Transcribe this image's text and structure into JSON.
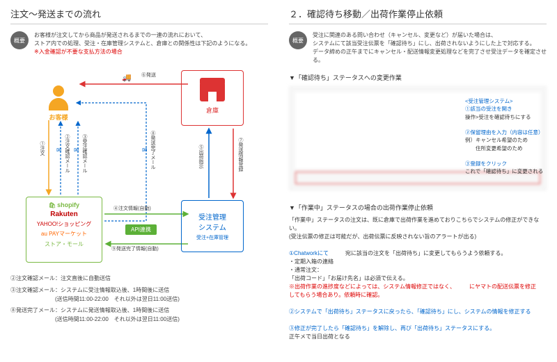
{
  "left": {
    "title": "注文～発送までの流れ",
    "badge": "概要",
    "summary_l1": "お客様が注文してから商品が発送されるまでの一連の流れにおいて、",
    "summary_l2": "ストア内での処理、受注・在庫管理システムと、倉庫との関係性は下記のようになる。",
    "summary_l3": "※入金確認が不要な支払方法の場合",
    "customer": "お客様",
    "warehouse": "倉庫",
    "oms_title": "受注管理\nシステム",
    "oms_sub": "受注+在庫管理",
    "shopify": "shopify",
    "rakuten": "Rakuten",
    "yahoo": "YAHOO!ショッピング",
    "aupay": "au PAYマーケット",
    "store": "ストア・モール",
    "api": "API連携",
    "arrows": {
      "order": "①注文",
      "confirm_mail": "②注文確認メール",
      "accept_mail": "③受注確認メール",
      "ship_done_mail": "⑧発送完了メール",
      "order_info": "④注文情報(自動)",
      "ship_done_info": "⑨発送完了情報(自動)",
      "ship_instr": "⑤出荷指示",
      "ship_report": "⑦発送情報登録",
      "shipping": "⑥発送"
    },
    "notes": {
      "n2": "②注文確認メール：注文直後に自動送信",
      "n3": "③注文確認メール：システムに受注情報取込後、1時間後に送信",
      "n3b": "(送信時間11:00-22:00　それ以外は翌日11:00送信)",
      "n8": "⑧発送完了メール：システムに発送情報取込後、1時間後に送信",
      "n8b": "(送信時間11:00-22:00　それ以外は翌日11:00送信)"
    }
  },
  "right": {
    "title": "２．確認待ち移動／出荷作業停止依頼",
    "badge": "概要",
    "summary_l1": "受注に関連のある問い合わせ（キャンセル、変更など）が届いた場合は、",
    "summary_l2": "システムにて該当受注伝票を「確認待ち」にし、出荷されないようにした上で対応する。",
    "summary_l3": "データ締めの正午までにキャンセル・配送情報変更処理などを完了させ受注データを確定させる。",
    "sec1": "▼「確認待ち」ステータスへの変更作業",
    "side_title": "<受注管理システム>",
    "s1": "①該当の受注を開き",
    "s1b": "操作>受注を確認待ちにする",
    "s2": "②保留理由を入力（内容は任意）",
    "s2a": "例）キャンセル希望のため",
    "s2b": "　　住所変更希望のため",
    "s3": "③登録をクリック",
    "s3b": "これで「確認待ち」に変更される",
    "sec2": "▼「作業中」ステータスの場合の出荷作業停止依頼",
    "w1": "「作業中」ステータスの注文は、既に倉庫で出荷作業を進めておりこちらでシステムの修正ができない。",
    "w1b": "(受注伝票の修正は可能だが、出荷伝票に反映されない旨のアラートが出る)",
    "w2a": "①Chatworkにて",
    "w2b": "宛に該当の注文を「出荷待ち」に変更してもらうよう依頼する。",
    "w3a": "・定期入箱の連絡",
    "w3b": "・通常注文：",
    "w3c": "「出荷コード」「お届け先名」は必須で伝える。",
    "w3d": "※出荷作業の進捗度などによっては、システム情報修正ではなく、",
    "w3e": "にヤマトの配送伝票を修正",
    "w3f": "してもらう場合あり。依頼時に確認。",
    "w4": "②システムで「出荷待ち」ステータスに戻ったら、「確認待ち」にし、システムの情報を修正する",
    "w5": "③修正が完了したら「確認待ち」を解除し、再び「出荷待ち」ステータスにする。",
    "w5b": "正午メで当日出荷となる"
  }
}
